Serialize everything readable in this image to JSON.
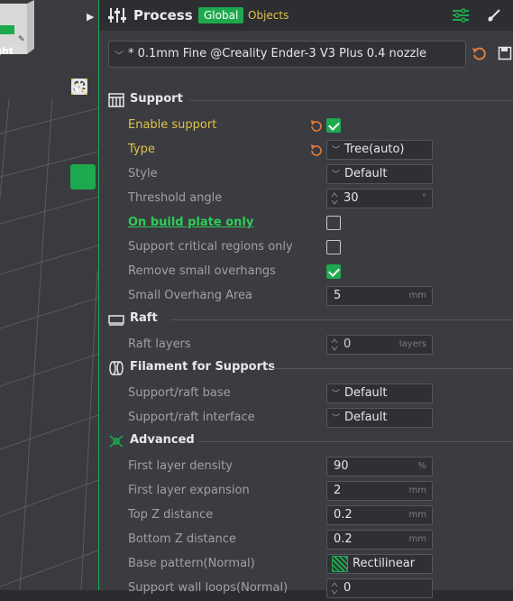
{
  "viewport": {
    "cube_label": "ght"
  },
  "process": {
    "title": "Process",
    "tab_global": "Global",
    "tab_objects": "Objects"
  },
  "preset": {
    "name": "* 0.1mm Fine @Creality Ender-3 V3 Plus 0.4 nozzle"
  },
  "sections": {
    "support": "Support",
    "raft": "Raft",
    "filament": "Filament for Supports",
    "advanced": "Advanced"
  },
  "rows": {
    "enable_support": {
      "label": "Enable support",
      "checked": true
    },
    "type": {
      "label": "Type",
      "value": "Tree(auto)"
    },
    "style": {
      "label": "Style",
      "value": "Default"
    },
    "threshold_angle": {
      "label": "Threshold angle",
      "value": "30",
      "unit": "°"
    },
    "on_build_plate_only": {
      "label": "On build plate only",
      "checked": false
    },
    "support_critical": {
      "label": "Support critical regions only",
      "checked": false
    },
    "remove_small_overhangs": {
      "label": "Remove small overhangs",
      "checked": true
    },
    "small_overhang_area": {
      "label": "Small Overhang Area",
      "value": "5",
      "unit": "mm"
    },
    "raft_layers": {
      "label": "Raft layers",
      "value": "0",
      "unit": "layers"
    },
    "support_raft_base": {
      "label": "Support/raft base",
      "value": "Default"
    },
    "support_raft_interface": {
      "label": "Support/raft interface",
      "value": "Default"
    },
    "first_layer_density": {
      "label": "First layer density",
      "value": "90",
      "unit": "%"
    },
    "first_layer_expansion": {
      "label": "First layer expansion",
      "value": "2",
      "unit": "mm"
    },
    "top_z_distance": {
      "label": "Top Z distance",
      "value": "0.2",
      "unit": "mm"
    },
    "bottom_z_distance": {
      "label": "Bottom Z distance",
      "value": "0.2",
      "unit": "mm"
    },
    "base_pattern": {
      "label": "Base pattern(Normal)",
      "value": "Rectilinear"
    },
    "support_wall_loops": {
      "label": "Support wall loops(Normal)",
      "value": "0"
    }
  },
  "colors": {
    "accent": "#1ea94f",
    "modified": "#e0c24a",
    "reset": "#e07b39"
  }
}
